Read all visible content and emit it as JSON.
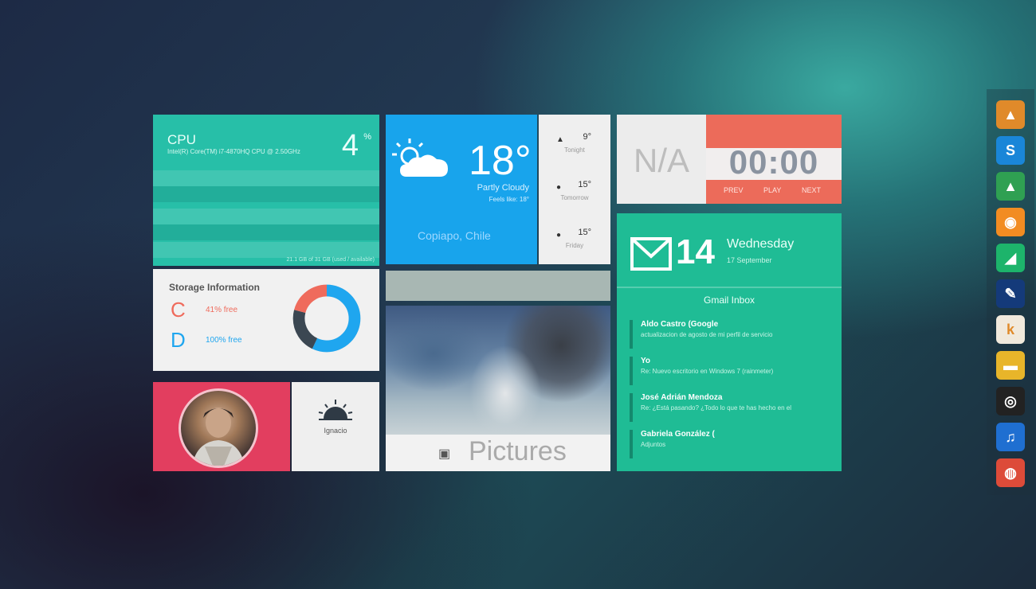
{
  "cpu": {
    "title": "CPU",
    "details": "Intel(R) Core(TM) i7-4870HQ CPU @ 2.50GHz",
    "value": "4",
    "unit": "%",
    "footer": "21.1 GB of 31 GB (used / available)"
  },
  "storage": {
    "title": "Storage Information",
    "drives": [
      {
        "letter": "C",
        "free": "41% free",
        "color": "#ef6b5c"
      },
      {
        "letter": "D",
        "free": "100% free",
        "color": "#1fa6ef"
      }
    ],
    "donut_fractions": [
      0.57,
      0.22,
      0.21
    ]
  },
  "profile": {
    "name": "Ignacio"
  },
  "weather": {
    "temp": "18°",
    "condition": "Partly Cloudy",
    "feels": "Feels like: 18°",
    "location": "Copiapo, Chile"
  },
  "forecast": [
    {
      "temp": "9°",
      "day": "Tonight"
    },
    {
      "temp": "15°",
      "day": "Tomorrow"
    },
    {
      "temp": "15°",
      "day": "Friday"
    }
  ],
  "pictures": {
    "label": "Pictures"
  },
  "music": {
    "track": "N/A",
    "time": "00:00",
    "prev": "PREV",
    "play": "PLAY",
    "next": "NEXT"
  },
  "mail": {
    "day": "14",
    "weekday": "Wednesday",
    "date": "17 September",
    "inbox": "Gmail Inbox",
    "messages": [
      {
        "from": "Aldo Castro (Google",
        "snippet": "actualizacion de agosto de mi perfil de servicio"
      },
      {
        "from": "Yo",
        "snippet": "Re: Nuevo escritorio en Windows 7 (rainmeter)"
      },
      {
        "from": "José Adrián Mendoza",
        "snippet": "Re: ¿Está pasando? ¿Todo lo que te has hecho en el"
      },
      {
        "from": "Gabriela González (",
        "snippet": "Adjuntos"
      }
    ]
  },
  "dock": [
    {
      "icon": "vlc-icon",
      "color": "#e08a2a",
      "glyph": "▲"
    },
    {
      "icon": "skype-icon",
      "color": "#1a86d8",
      "glyph": "S"
    },
    {
      "icon": "google-drive-icon",
      "color": "#2fa052",
      "glyph": "▲"
    },
    {
      "icon": "music-app-icon",
      "color": "#f28c22",
      "glyph": "◉"
    },
    {
      "icon": "maps-icon",
      "color": "#1db46b",
      "glyph": "◢"
    },
    {
      "icon": "feather-icon",
      "color": "#143a7a",
      "glyph": "✎"
    },
    {
      "icon": "k-app-icon",
      "color": "#f1e9dc",
      "glyph": "k"
    },
    {
      "icon": "folder-icon",
      "color": "#e8b52a",
      "glyph": "▬"
    },
    {
      "icon": "steam-icon",
      "color": "#222222",
      "glyph": "◎"
    },
    {
      "icon": "itunes-icon",
      "color": "#1f6fd1",
      "glyph": "♫"
    },
    {
      "icon": "chrome-icon",
      "color": "#dd4b39",
      "glyph": "◍"
    }
  ]
}
